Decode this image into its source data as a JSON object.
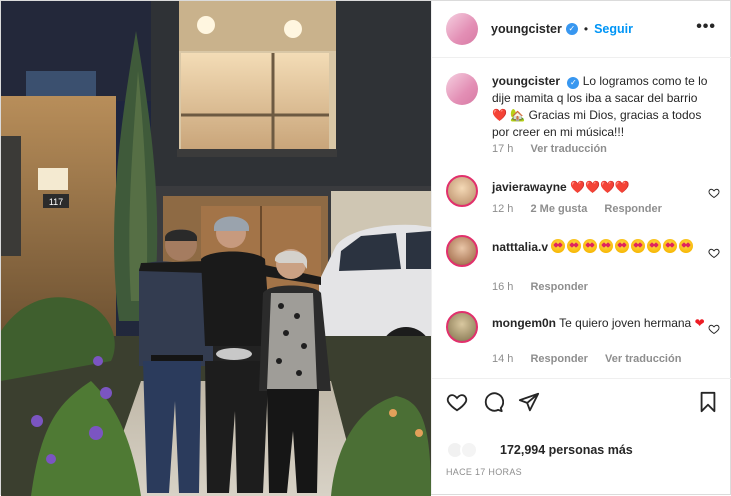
{
  "photo": {
    "house_number": "117",
    "alt_subject": "family-photo"
  },
  "header": {
    "username": "youngcister",
    "separator": "•",
    "follow_label": "Seguir",
    "more_label": "•••"
  },
  "caption": {
    "username": "youngcister",
    "text_part1": "Lo logramos como te lo dije mamita q los iba a sacar del barrio",
    "heart": "❤️",
    "house_emoji": "🏡",
    "text_part2": "Gracias mi Dios, gracias a todos por creer en mi música!!!",
    "time": "17 h",
    "translate": "Ver traducción"
  },
  "comments": [
    {
      "username": "javierawayne",
      "text": "❤️❤️❤️❤️",
      "time": "12 h",
      "likes": "2 Me gusta",
      "reply": "Responder"
    },
    {
      "username": "natttalia.v",
      "emoji_count": 9,
      "time": "16 h",
      "reply": "Responder"
    },
    {
      "username": "mongem0n",
      "text": "Te quiero joven hermana",
      "time": "14 h",
      "reply": "Responder",
      "translate": "Ver traducción"
    }
  ],
  "footer": {
    "likes_count": "172,994",
    "likes_suffix": "personas más",
    "time_ago": "HACE 17 HORAS"
  },
  "colors": {
    "accent": "#0095f6",
    "verified": "#3897f0",
    "heart_red": "#ed1c24",
    "muted": "#8e8e8e"
  }
}
